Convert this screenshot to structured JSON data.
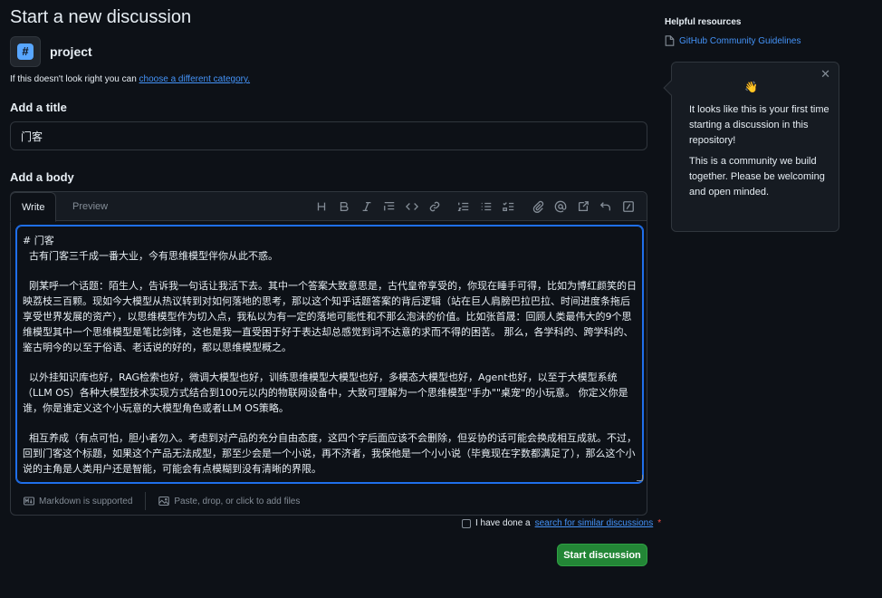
{
  "page": {
    "title": "Start a new discussion"
  },
  "category": {
    "name": "project",
    "note_prefix": "If this doesn't look right you can ",
    "note_link": "choose a different category."
  },
  "title_section": {
    "label": "Add a title",
    "value": "门客"
  },
  "body_section": {
    "label": "Add a body",
    "tabs": [
      "Write",
      "Preview"
    ],
    "toolbar_icons": [
      "heading-icon",
      "bold-icon",
      "italic-icon",
      "quote-icon",
      "code-icon",
      "link-icon",
      "ordered-list-icon",
      "unordered-list-icon",
      "task-list-icon",
      "attach-icon",
      "mention-icon",
      "reference-icon",
      "undo-icon",
      "slash-command-icon"
    ],
    "value": "# 门客\n  古有门客三千成一番大业，今有思维模型伴你从此不惑。\n\n  刚某呼一个话题：陌生人，告诉我一句话让我活下去。其中一个答案大致意思是，古代皇帝享受的，你现在睡手可得，比如为博红颜笑的日映荔枝三百颗。现如今大模型从热议转到对如何落地的思考，那以这个知乎话题答案的背后逻辑（站在巨人肩膀巴拉巴拉、时间进度条拖后享受世界发展的资产），以思维模型作为切入点，我私以为有一定的落地可能性和不那么泡沫的价值。比如张首晟：回顾人类最伟大的9个思维模型其中一个思维模型是笔比剑锋，这也是我一直受困于好于表达却总感觉到词不达意的求而不得的困苦。 那么，各学科的、跨学科的、鉴古明今的以至于俗语、老话说的好的，都以思维模型概之。\n\n  以外挂知识库也好，RAG检索也好，微调大模型也好，训练思维模型大模型也好，多模态大模型也好，Agent也好，以至于大模型系统（LLM OS）各种大模型技术实现方式结合到100元以内的物联网设备中，大致可理解为一个思维模型\"手办\"\"桌宠\"的小玩意。 你定义你是谁，你是谁定义这个小玩意的大模型角色或者LLM OS策略。\n\n  相互养成（有点可怕，胆小者勿入。考虑到对产品的充分自由态度，这四个字后面应该不会删除，但妥协的话可能会换成相互成就。不过，回到门客这个标题，如果这个产品无法成型，那至少会是一个小说，再不济者，我保他是一个小小说（毕竟现在字数都满足了），那么这个小说的主角是人类用户还是智能，可能会有点模糊到没有清晰的界限。",
    "footer_markdown": "Markdown is supported",
    "footer_attach": "Paste, drop, or click to add files"
  },
  "similar_check": {
    "prefix": "I have done a ",
    "link": "search for similar discussions",
    "required_mark": "*"
  },
  "submit": {
    "label": "Start discussion"
  },
  "sidebar": {
    "resources_title": "Helpful resources",
    "guidelines_link": "GitHub Community Guidelines"
  },
  "popover": {
    "emoji": "👋",
    "text1": "It looks like this is your first time starting a discussion in this repository!",
    "text2": "This is a community we build together. Please be welcoming and open minded.",
    "close": "✕"
  },
  "colors": {
    "background": "#0d1117",
    "accent_link": "#4493f8",
    "button_green": "#238636",
    "focus_border": "#1f6feb"
  }
}
